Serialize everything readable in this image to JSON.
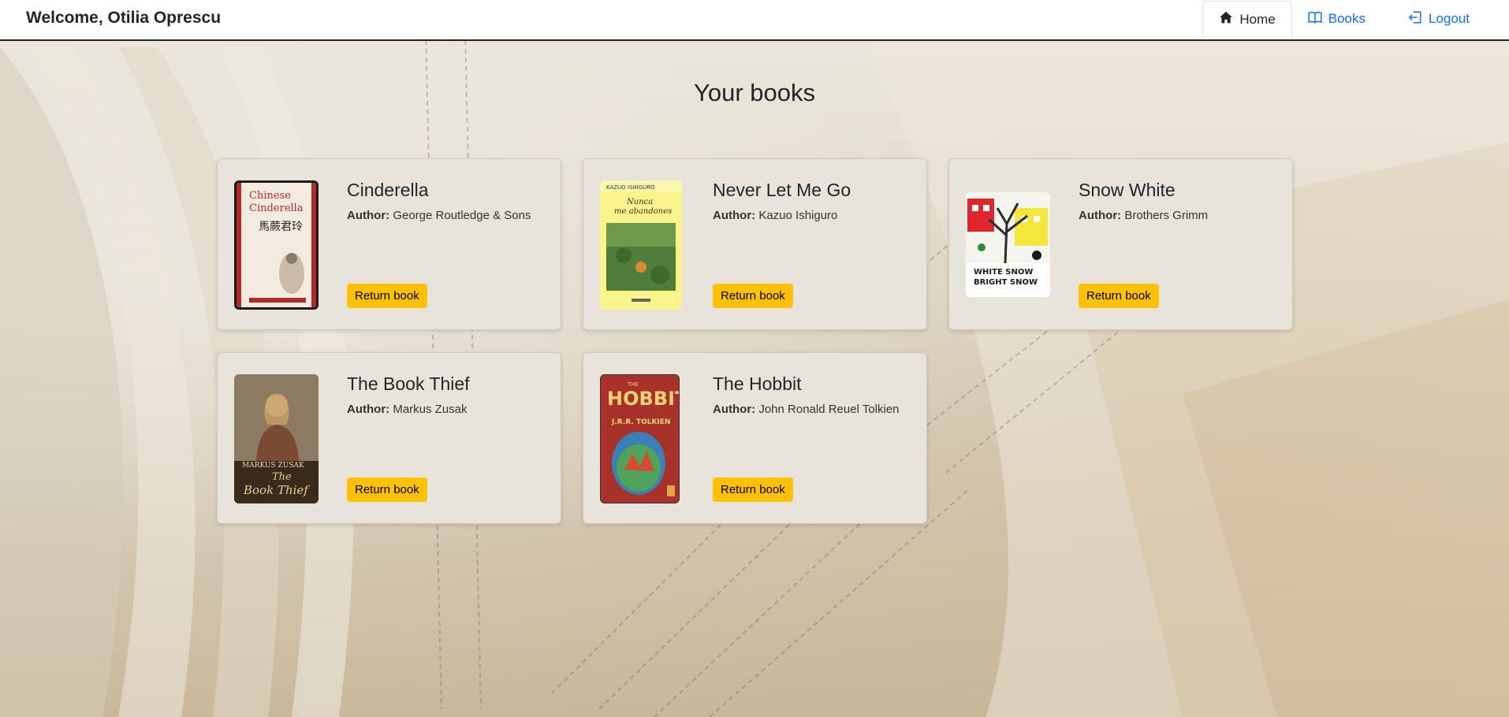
{
  "navbar": {
    "welcome": "Welcome, Otilia Oprescu",
    "home_label": "Home",
    "books_label": "Books",
    "logout_label": "Logout"
  },
  "page_title": "Your books",
  "books": [
    {
      "title": "Cinderella",
      "author_label": "Author:",
      "author": "George Routledge & Sons",
      "button": "Return book",
      "cover_text": [
        "Chinese",
        "Cinderella",
        "馬蕨君玲"
      ]
    },
    {
      "title": "Never Let Me Go",
      "author_label": "Author:",
      "author": "Kazuo Ishiguro",
      "button": "Return book",
      "cover_text": [
        "KAZUO ISHIGURO",
        "Nunca",
        "me abandones"
      ]
    },
    {
      "title": "Snow White",
      "author_label": "Author:",
      "author": "Brothers Grimm",
      "button": "Return book",
      "cover_text": [
        "WHITE SNOW",
        "BRIGHT SNOW"
      ]
    },
    {
      "title": "The Book Thief",
      "author_label": "Author:",
      "author": "Markus Zusak",
      "button": "Return book",
      "cover_text": [
        "MARKUS ZUSAK",
        "The",
        "Book Thief"
      ]
    },
    {
      "title": "The Hobbit",
      "author_label": "Author:",
      "author": "John Ronald Reuel Tolkien",
      "button": "Return book",
      "cover_text": [
        "THE",
        "HOBBIT",
        "J.R.R. TOLKIEN"
      ]
    }
  ],
  "colors": {
    "accent_button": "#ffc107",
    "link": "#0d6efd",
    "card_bg": "#e8e4dc"
  }
}
